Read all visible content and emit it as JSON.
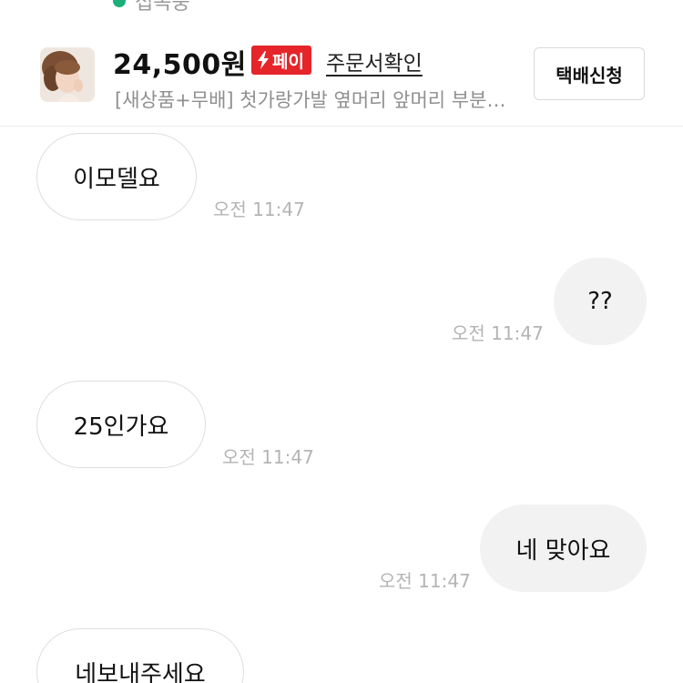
{
  "header": {
    "status_text": "접속중",
    "status_color": "#19b07a"
  },
  "product": {
    "price": "24,500원",
    "pay_badge": "페이",
    "pay_badge_color": "#e5252a",
    "order_link": "주문서확인",
    "description": "[새상품+무배] 첫가랑가발 옆머리 앞머리 부분…",
    "delivery_button": "택배신청"
  },
  "messages": [
    {
      "side": "in",
      "text": "이모델요",
      "time": "오전 11:47"
    },
    {
      "side": "out",
      "text": "??",
      "time": "오전 11:47"
    },
    {
      "side": "in",
      "text": "25인가요",
      "time": "오전 11:47"
    },
    {
      "side": "out",
      "text": "네 맞아요",
      "time": "오전 11:47"
    },
    {
      "side": "in",
      "text": "네보내주세요"
    }
  ]
}
